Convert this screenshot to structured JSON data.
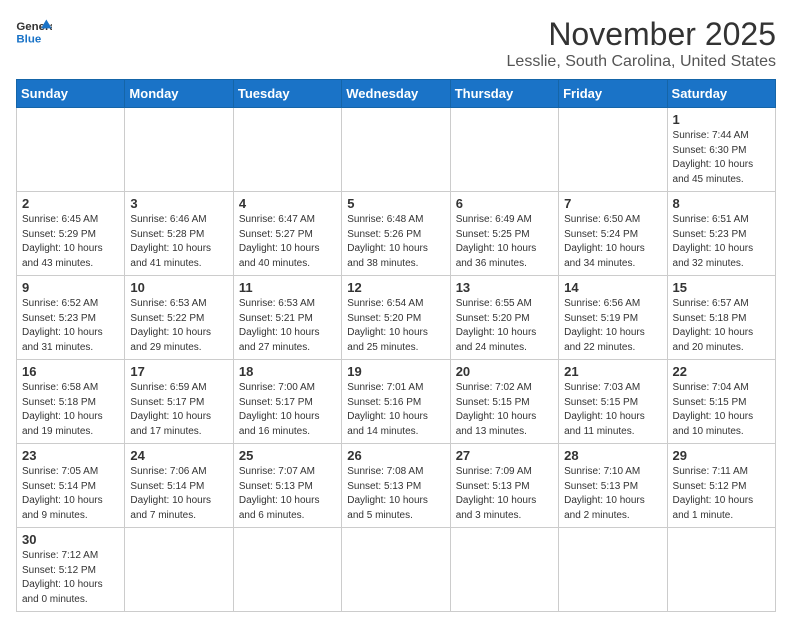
{
  "header": {
    "logo_general": "General",
    "logo_blue": "Blue",
    "month": "November 2025",
    "location": "Lesslie, South Carolina, United States"
  },
  "days_of_week": [
    "Sunday",
    "Monday",
    "Tuesday",
    "Wednesday",
    "Thursday",
    "Friday",
    "Saturday"
  ],
  "weeks": [
    [
      {
        "day": "",
        "info": ""
      },
      {
        "day": "",
        "info": ""
      },
      {
        "day": "",
        "info": ""
      },
      {
        "day": "",
        "info": ""
      },
      {
        "day": "",
        "info": ""
      },
      {
        "day": "",
        "info": ""
      },
      {
        "day": "1",
        "info": "Sunrise: 7:44 AM\nSunset: 6:30 PM\nDaylight: 10 hours and 45 minutes."
      }
    ],
    [
      {
        "day": "2",
        "info": "Sunrise: 6:45 AM\nSunset: 5:29 PM\nDaylight: 10 hours and 43 minutes."
      },
      {
        "day": "3",
        "info": "Sunrise: 6:46 AM\nSunset: 5:28 PM\nDaylight: 10 hours and 41 minutes."
      },
      {
        "day": "4",
        "info": "Sunrise: 6:47 AM\nSunset: 5:27 PM\nDaylight: 10 hours and 40 minutes."
      },
      {
        "day": "5",
        "info": "Sunrise: 6:48 AM\nSunset: 5:26 PM\nDaylight: 10 hours and 38 minutes."
      },
      {
        "day": "6",
        "info": "Sunrise: 6:49 AM\nSunset: 5:25 PM\nDaylight: 10 hours and 36 minutes."
      },
      {
        "day": "7",
        "info": "Sunrise: 6:50 AM\nSunset: 5:24 PM\nDaylight: 10 hours and 34 minutes."
      },
      {
        "day": "8",
        "info": "Sunrise: 6:51 AM\nSunset: 5:23 PM\nDaylight: 10 hours and 32 minutes."
      }
    ],
    [
      {
        "day": "9",
        "info": "Sunrise: 6:52 AM\nSunset: 5:23 PM\nDaylight: 10 hours and 31 minutes."
      },
      {
        "day": "10",
        "info": "Sunrise: 6:53 AM\nSunset: 5:22 PM\nDaylight: 10 hours and 29 minutes."
      },
      {
        "day": "11",
        "info": "Sunrise: 6:53 AM\nSunset: 5:21 PM\nDaylight: 10 hours and 27 minutes."
      },
      {
        "day": "12",
        "info": "Sunrise: 6:54 AM\nSunset: 5:20 PM\nDaylight: 10 hours and 25 minutes."
      },
      {
        "day": "13",
        "info": "Sunrise: 6:55 AM\nSunset: 5:20 PM\nDaylight: 10 hours and 24 minutes."
      },
      {
        "day": "14",
        "info": "Sunrise: 6:56 AM\nSunset: 5:19 PM\nDaylight: 10 hours and 22 minutes."
      },
      {
        "day": "15",
        "info": "Sunrise: 6:57 AM\nSunset: 5:18 PM\nDaylight: 10 hours and 20 minutes."
      }
    ],
    [
      {
        "day": "16",
        "info": "Sunrise: 6:58 AM\nSunset: 5:18 PM\nDaylight: 10 hours and 19 minutes."
      },
      {
        "day": "17",
        "info": "Sunrise: 6:59 AM\nSunset: 5:17 PM\nDaylight: 10 hours and 17 minutes."
      },
      {
        "day": "18",
        "info": "Sunrise: 7:00 AM\nSunset: 5:17 PM\nDaylight: 10 hours and 16 minutes."
      },
      {
        "day": "19",
        "info": "Sunrise: 7:01 AM\nSunset: 5:16 PM\nDaylight: 10 hours and 14 minutes."
      },
      {
        "day": "20",
        "info": "Sunrise: 7:02 AM\nSunset: 5:15 PM\nDaylight: 10 hours and 13 minutes."
      },
      {
        "day": "21",
        "info": "Sunrise: 7:03 AM\nSunset: 5:15 PM\nDaylight: 10 hours and 11 minutes."
      },
      {
        "day": "22",
        "info": "Sunrise: 7:04 AM\nSunset: 5:15 PM\nDaylight: 10 hours and 10 minutes."
      }
    ],
    [
      {
        "day": "23",
        "info": "Sunrise: 7:05 AM\nSunset: 5:14 PM\nDaylight: 10 hours and 9 minutes."
      },
      {
        "day": "24",
        "info": "Sunrise: 7:06 AM\nSunset: 5:14 PM\nDaylight: 10 hours and 7 minutes."
      },
      {
        "day": "25",
        "info": "Sunrise: 7:07 AM\nSunset: 5:13 PM\nDaylight: 10 hours and 6 minutes."
      },
      {
        "day": "26",
        "info": "Sunrise: 7:08 AM\nSunset: 5:13 PM\nDaylight: 10 hours and 5 minutes."
      },
      {
        "day": "27",
        "info": "Sunrise: 7:09 AM\nSunset: 5:13 PM\nDaylight: 10 hours and 3 minutes."
      },
      {
        "day": "28",
        "info": "Sunrise: 7:10 AM\nSunset: 5:13 PM\nDaylight: 10 hours and 2 minutes."
      },
      {
        "day": "29",
        "info": "Sunrise: 7:11 AM\nSunset: 5:12 PM\nDaylight: 10 hours and 1 minute."
      }
    ],
    [
      {
        "day": "30",
        "info": "Sunrise: 7:12 AM\nSunset: 5:12 PM\nDaylight: 10 hours and 0 minutes."
      },
      {
        "day": "",
        "info": ""
      },
      {
        "day": "",
        "info": ""
      },
      {
        "day": "",
        "info": ""
      },
      {
        "day": "",
        "info": ""
      },
      {
        "day": "",
        "info": ""
      },
      {
        "day": "",
        "info": ""
      }
    ]
  ]
}
